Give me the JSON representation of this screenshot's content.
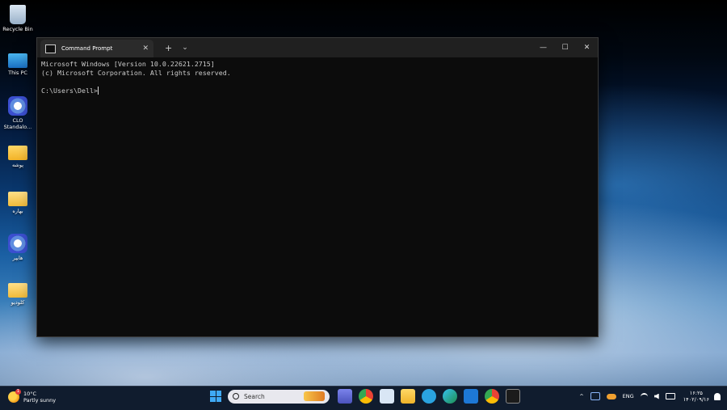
{
  "desktop": {
    "icons": [
      {
        "label": "Recycle Bin",
        "icon": "recycle-bin-icon"
      },
      {
        "label": "This PC",
        "icon": "monitor-icon"
      },
      {
        "label": "CLO Standalo...",
        "icon": "clo-app-icon"
      },
      {
        "label": "پوشه",
        "icon": "folder-icon"
      },
      {
        "label": "بهاره",
        "icon": "folder-icon"
      },
      {
        "label": "هایپر",
        "icon": "clo-app-icon"
      },
      {
        "label": "کلودیو",
        "icon": "folder-icon"
      }
    ]
  },
  "terminal": {
    "tab_title": "Command Prompt",
    "tab_close": "✕",
    "new_tab": "+",
    "dropdown": "⌄",
    "minimize": "—",
    "maximize": "☐",
    "close": "✕",
    "lines": [
      "Microsoft Windows [Version 10.0.22621.2715]",
      "(c) Microsoft Corporation. All rights reserved.",
      "",
      "C:\\Users\\Dell>"
    ]
  },
  "taskbar": {
    "weather": {
      "temp": "10°C",
      "condition": "Partly sunny",
      "badge": "1"
    },
    "search_placeholder": "Search",
    "apps": [
      "teams-icon",
      "chrome-icon",
      "snipping-icon",
      "file-explorer-icon",
      "telegram-icon",
      "edge-icon",
      "remote-icon",
      "chrome-badge-icon",
      "terminal-icon"
    ],
    "tray": {
      "chevron": "^",
      "language": "ENG",
      "time": "۱۶:۲۵",
      "date": "۱۴۰۲/۰۹/۱۶"
    }
  },
  "colors": {
    "console_bg": "#0c0c0c",
    "titlebar_bg": "#202020",
    "taskbar_bg": "#101c2e",
    "accent": "#3fa9f5"
  }
}
